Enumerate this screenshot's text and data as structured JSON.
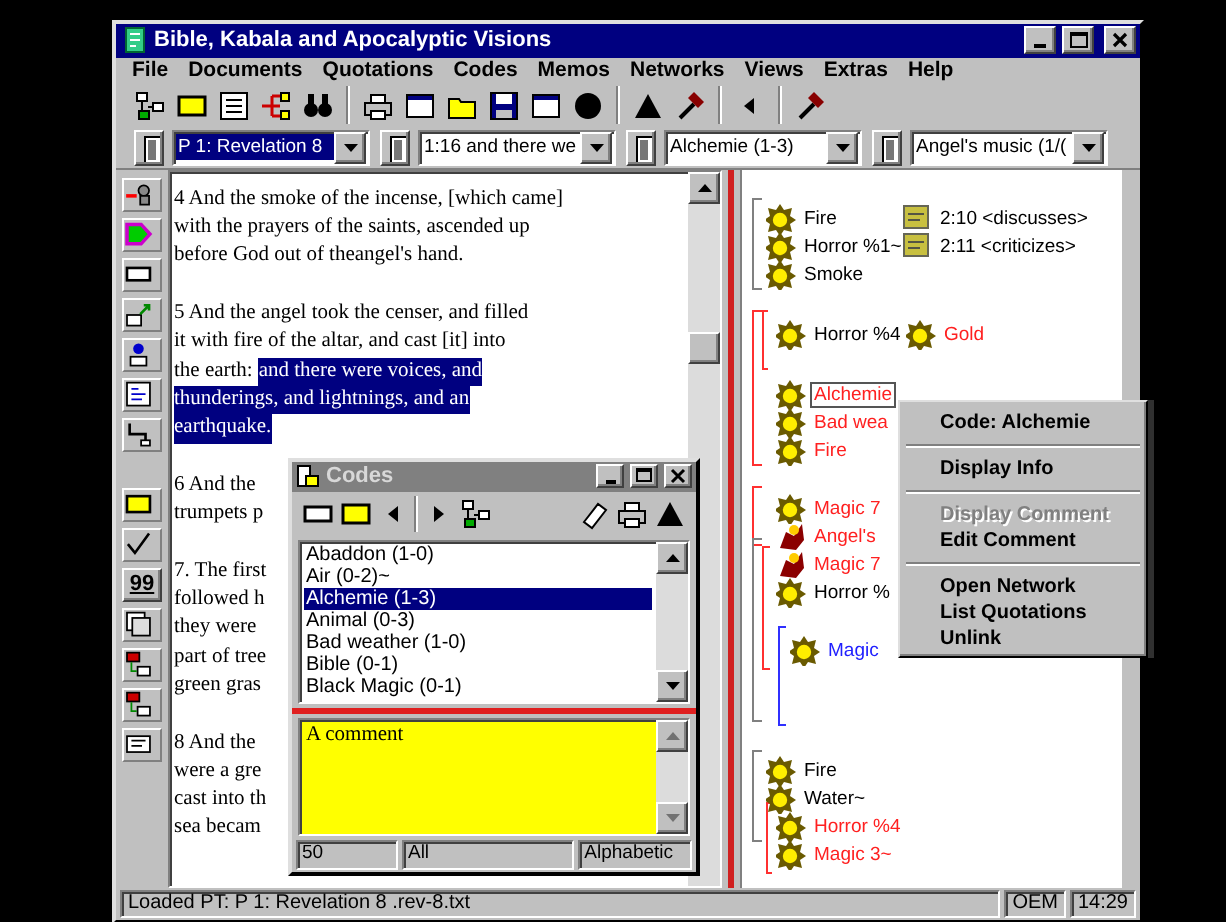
{
  "window": {
    "title": "Bible, Kabala and Apocalyptic Visions"
  },
  "menu": [
    "File",
    "Documents",
    "Quotations",
    "Codes",
    "Memos",
    "Networks",
    "Views",
    "Extras",
    "Help"
  ],
  "combos": [
    {
      "value": "P 1: Revelation 8",
      "highlighted": true
    },
    {
      "value": "1:16 and there we",
      "highlighted": false
    },
    {
      "value": "Alchemie (1-3)",
      "highlighted": false
    },
    {
      "value": "Angel's music (1/(",
      "highlighted": false
    }
  ],
  "side_toolbar": {
    "quote_button": "99"
  },
  "document": {
    "paragraphs": [
      [
        [
          {
            "text": "4  And the smoke of the incense, [which came]",
            "selected": false
          }
        ],
        [
          {
            "text": "with the prayers of the saints, ascended up",
            "selected": false
          }
        ],
        [
          {
            "text": "before God out of theangel's hand.",
            "selected": false
          }
        ]
      ],
      [
        [
          {
            "text": "5  And the angel took the censer, and filled",
            "selected": false
          }
        ],
        [
          {
            "text": "it with fire of the altar, and cast [it] into",
            "selected": false
          }
        ],
        [
          {
            "text": "the earth:",
            "selected": false
          },
          {
            "text": "and there were voices, and",
            "selected": true
          }
        ],
        [
          {
            "text": "thunderings, and lightnings, and an",
            "selected": true
          }
        ],
        [
          {
            "text": "earthquake.",
            "selected": true
          }
        ]
      ],
      [
        [
          {
            "text": "6  And the",
            "selected": false
          }
        ],
        [
          {
            "text": "trumpets p",
            "selected": false
          }
        ]
      ],
      [
        [
          {
            "text": "7. The first",
            "selected": false
          }
        ],
        [
          {
            "text": "followed h",
            "selected": false
          }
        ],
        [
          {
            "text": "they were",
            "selected": false
          }
        ],
        [
          {
            "text": "part of tree",
            "selected": false
          }
        ],
        [
          {
            "text": "green gras",
            "selected": false
          }
        ]
      ],
      [
        [
          {
            "text": "8  And the",
            "selected": false
          }
        ],
        [
          {
            "text": "were a gre",
            "selected": false
          }
        ],
        [
          {
            "text": "cast into th",
            "selected": false
          }
        ],
        [
          {
            "text": "sea becam",
            "selected": false
          }
        ]
      ]
    ]
  },
  "network": {
    "nodes": [
      {
        "label": "Fire",
        "kind": "code",
        "color": "#000000",
        "selected": false
      },
      {
        "label": "Horror %1~",
        "kind": "code",
        "color": "#000000",
        "selected": false
      },
      {
        "label": "Smoke",
        "kind": "code",
        "color": "#000000",
        "selected": false
      },
      {
        "label": "2:10 <discusses>",
        "kind": "link",
        "color": "#000000",
        "selected": false
      },
      {
        "label": "2:11 <criticizes>",
        "kind": "link",
        "color": "#000000",
        "selected": false
      },
      {
        "label": "Horror %4",
        "kind": "code",
        "color": "#000000",
        "selected": false
      },
      {
        "label": "Gold",
        "kind": "code",
        "color": "#ff2020",
        "selected": false
      },
      {
        "label": "Alchemie",
        "kind": "code",
        "color": "#ff2020",
        "selected": true
      },
      {
        "label": "Bad wea",
        "kind": "code",
        "color": "#ff2020",
        "selected": false
      },
      {
        "label": "Fire",
        "kind": "code",
        "color": "#ff2020",
        "selected": false
      },
      {
        "label": "Magic 7",
        "kind": "code",
        "color": "#ff2020",
        "selected": false
      },
      {
        "label": "Angel's",
        "kind": "figure",
        "color": "#ff2020",
        "selected": false
      },
      {
        "label": "Magic 7",
        "kind": "figure",
        "color": "#ff2020",
        "selected": false
      },
      {
        "label": "Horror %",
        "kind": "code",
        "color": "#000000",
        "selected": false
      },
      {
        "label": "Magic",
        "kind": "code",
        "color": "#2020ff",
        "selected": false
      },
      {
        "label": "Fire",
        "kind": "code",
        "color": "#000000",
        "selected": false
      },
      {
        "label": "Water~",
        "kind": "code",
        "color": "#000000",
        "selected": false
      },
      {
        "label": "Horror %4",
        "kind": "code",
        "color": "#ff2020",
        "selected": false
      },
      {
        "label": "Magic 3~",
        "kind": "code",
        "color": "#ff2020",
        "selected": false
      }
    ]
  },
  "codes_window": {
    "title": "Codes",
    "items": [
      {
        "label": "Abaddon (1-0)",
        "selected": false
      },
      {
        "label": "Air (0-2)~",
        "selected": false
      },
      {
        "label": "Alchemie (1-3)",
        "selected": true
      },
      {
        "label": "Animal (0-3)",
        "selected": false
      },
      {
        "label": "Bad weather (1-0)",
        "selected": false
      },
      {
        "label": "Bible (0-1)",
        "selected": false
      },
      {
        "label": "Black Magic (0-1)",
        "selected": false
      }
    ],
    "comment": "A comment",
    "footer": [
      "50",
      "All",
      "Alphabetic"
    ]
  },
  "context_menu": {
    "items": [
      {
        "kind": "item",
        "label": "Code: Alchemie",
        "disabled": false
      },
      {
        "kind": "separator"
      },
      {
        "kind": "item",
        "label": "Display Info",
        "disabled": false
      },
      {
        "kind": "separator"
      },
      {
        "kind": "item",
        "label": "Display Comment",
        "disabled": true
      },
      {
        "kind": "item",
        "label": "Edit Comment",
        "disabled": false
      },
      {
        "kind": "separator"
      },
      {
        "kind": "item",
        "label": "Open Network",
        "disabled": false
      },
      {
        "kind": "item",
        "label": "List Quotations",
        "disabled": false
      },
      {
        "kind": "item",
        "label": "Unlink",
        "disabled": false
      }
    ]
  },
  "status_bar": {
    "message": "Loaded PT: P 1: Revelation 8 .rev-8.txt",
    "cells": [
      "OEM",
      "14:29"
    ]
  }
}
